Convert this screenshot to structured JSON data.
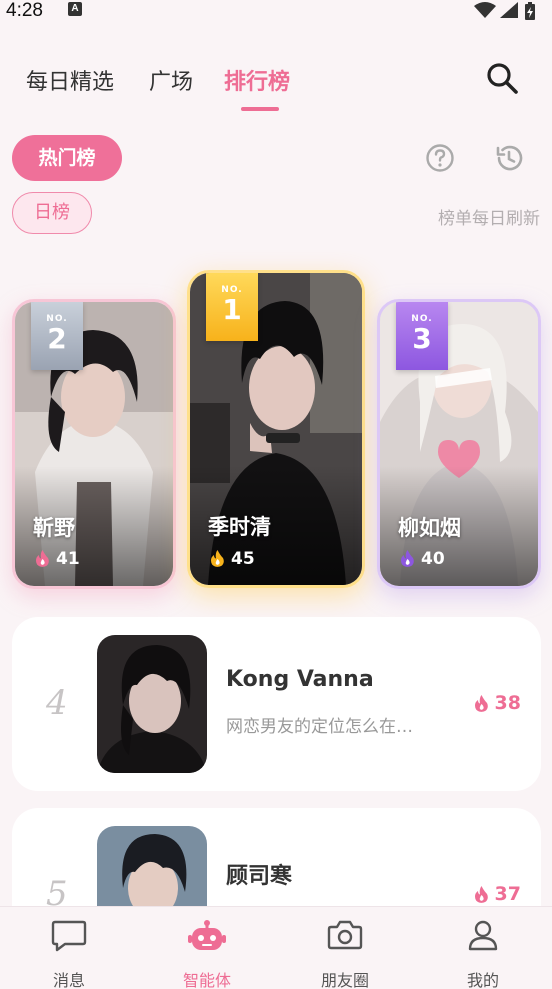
{
  "status_bar": {
    "time": "4:28",
    "a_badge": "A"
  },
  "top_tabs": [
    {
      "label": "每日精选",
      "active": false
    },
    {
      "label": "广场",
      "active": false
    },
    {
      "label": "排行榜",
      "active": true
    }
  ],
  "filters": {
    "hot_label": "热门榜",
    "daily_label": "日榜",
    "refresh_note": "榜单每日刷新"
  },
  "podium": [
    {
      "rank_prefix": "NO.",
      "rank": "2",
      "name": "靳野",
      "heat": "41",
      "heat_color": "#ee6d94"
    },
    {
      "rank_prefix": "NO.",
      "rank": "1",
      "name": "季时清",
      "heat": "45",
      "heat_color": "#f7b21b"
    },
    {
      "rank_prefix": "NO.",
      "rank": "3",
      "name": "柳如烟",
      "heat": "40",
      "heat_color": "#8d57e0"
    }
  ],
  "list": [
    {
      "rank": "4",
      "name": "Kong Vanna",
      "desc": "网恋男友的定位怎么在…",
      "heat": "38"
    },
    {
      "rank": "5",
      "name": "顾司寒",
      "desc": "",
      "heat": "37"
    }
  ],
  "bottom_nav": [
    {
      "label": "消息",
      "icon": "chat-icon",
      "active": false
    },
    {
      "label": "智能体",
      "icon": "robot-icon",
      "active": true
    },
    {
      "label": "朋友圈",
      "icon": "camera-icon",
      "active": false
    },
    {
      "label": "我的",
      "icon": "person-icon",
      "active": false
    }
  ],
  "colors": {
    "accent": "#ee6d94",
    "gold": "#f7b21b",
    "silver": "#9aa3b2",
    "purple": "#8d57e0"
  }
}
